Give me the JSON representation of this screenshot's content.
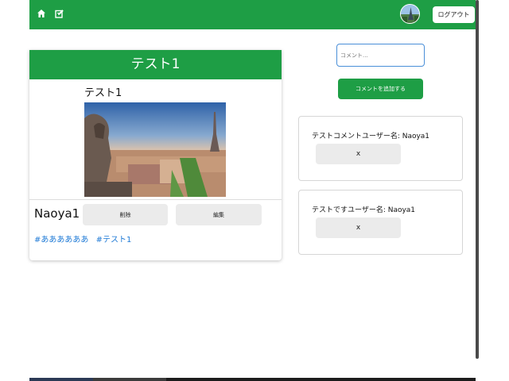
{
  "header": {
    "home_icon": "home-icon",
    "new_post_icon": "new-post-icon",
    "logout_label": "ログアウト",
    "brand_color": "#1e9e45"
  },
  "post": {
    "header_title": "テスト1",
    "title": "テスト1",
    "author": "Naoya1",
    "delete_label": "削除",
    "edit_label": "編集",
    "tags": [
      "#ああああああ",
      "#テスト1"
    ]
  },
  "comment_form": {
    "placeholder": "コメント...",
    "submit_label": "コメントを追加する"
  },
  "comments": [
    {
      "text": "テストコメントユーザー名: Naoya1",
      "delete_label": "x"
    },
    {
      "text": "テストですユーザー名: Naoya1",
      "delete_label": "x"
    }
  ]
}
